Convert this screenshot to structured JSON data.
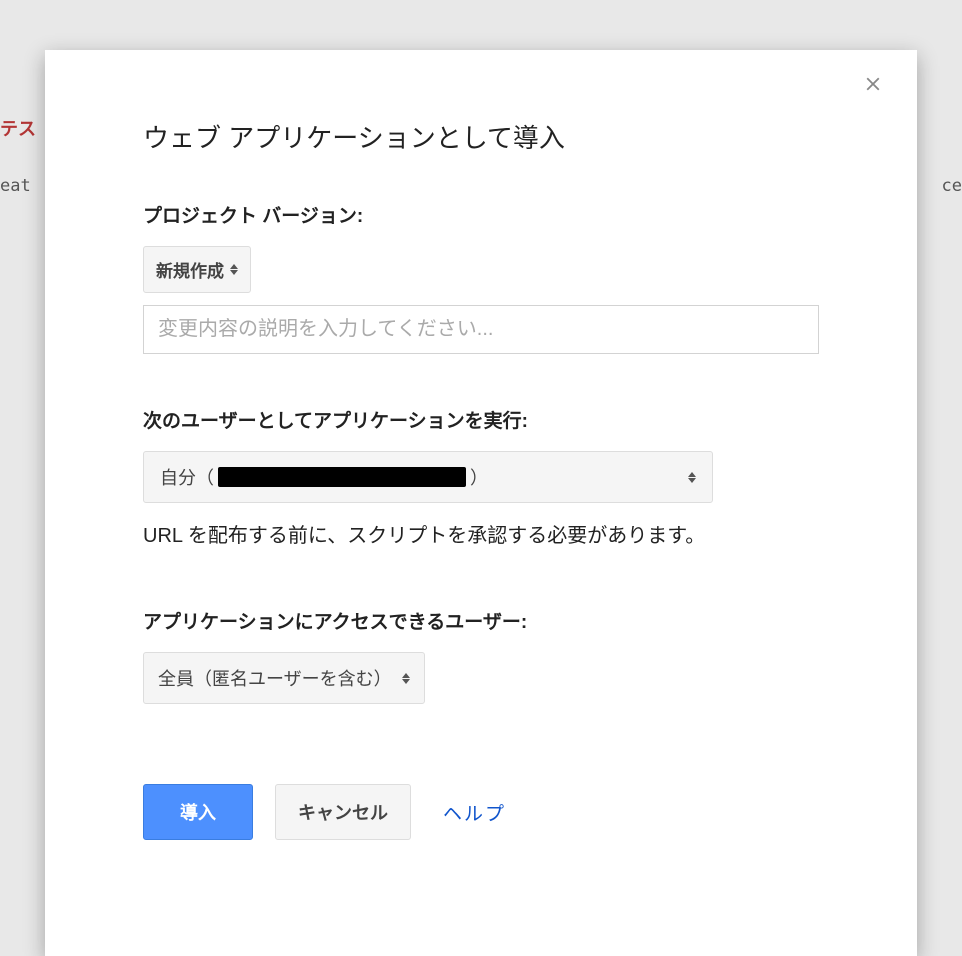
{
  "background": {
    "hint_left": "テス",
    "hint_left2": "eat",
    "hint_right": "ce"
  },
  "dialog": {
    "title": "ウェブ アプリケーションとして導入",
    "close_icon": "close",
    "version": {
      "label": "プロジェクト バージョン:",
      "dropdown_value": "新規作成",
      "description_placeholder": "変更内容の説明を入力してください...",
      "description_value": ""
    },
    "execute_as": {
      "label": "次のユーザーとしてアプリケーションを実行:",
      "selected_prefix": "自分（",
      "selected_suffix": "）",
      "info_text": "URL を配布する前に、スクリプトを承認する必要があります。"
    },
    "access": {
      "label": "アプリケーションにアクセスできるユーザー:",
      "selected": "全員（匿名ユーザーを含む）"
    },
    "buttons": {
      "deploy": "導入",
      "cancel": "キャンセル",
      "help": "ヘルプ"
    }
  }
}
